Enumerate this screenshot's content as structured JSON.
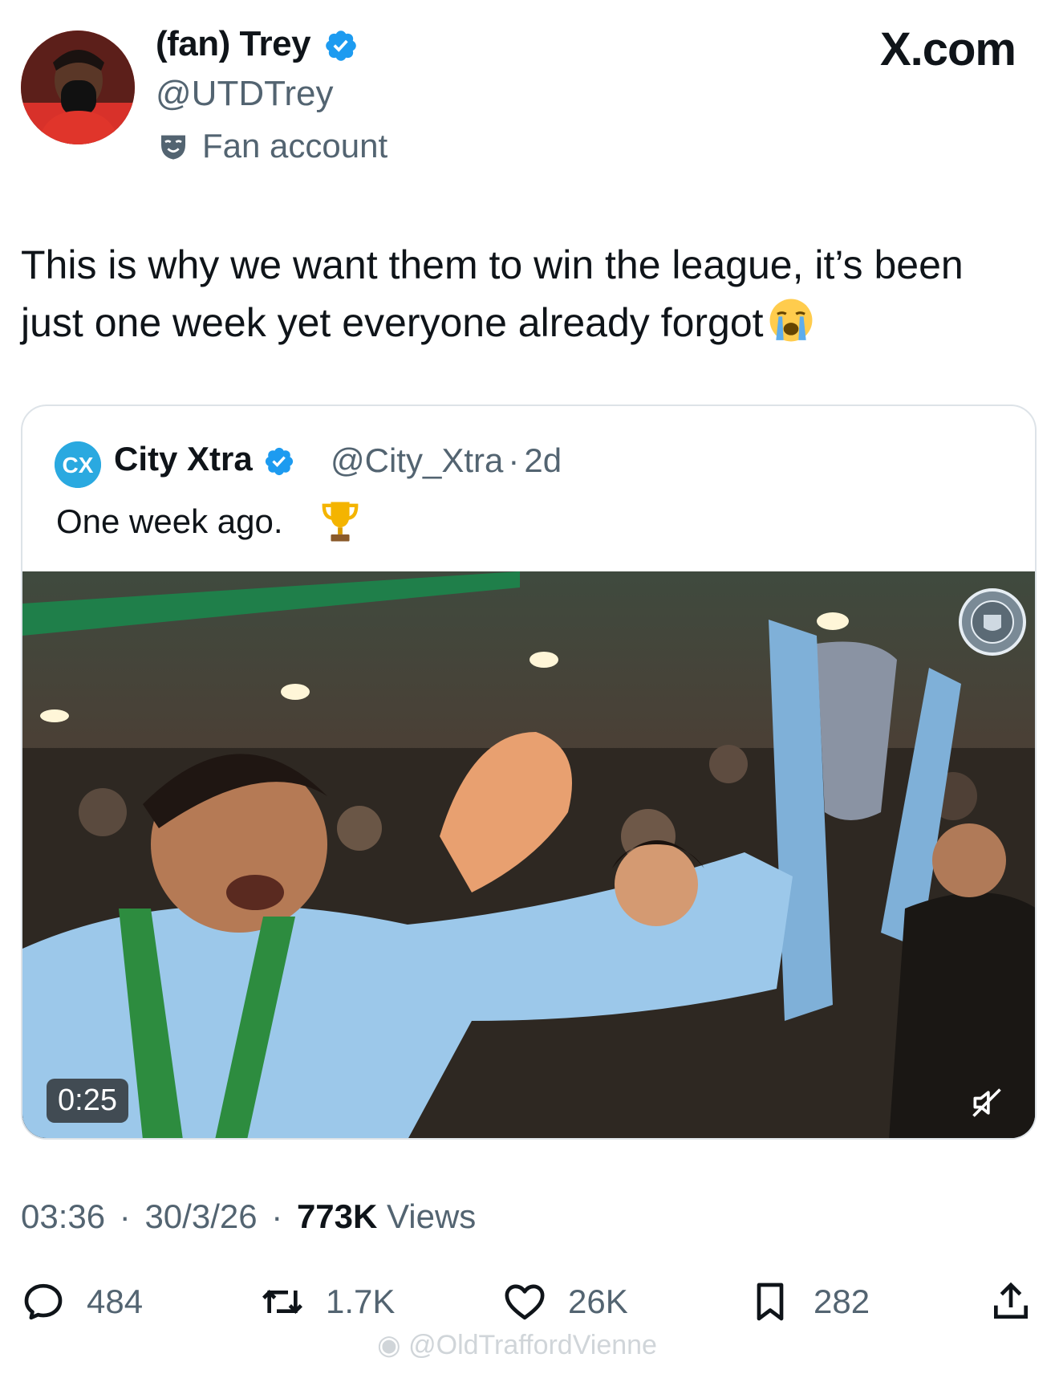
{
  "author": {
    "display_name": "(fan) Trey",
    "handle": "@UTDTrey",
    "label": "Fan account",
    "verified_icon": "verified-badge-icon"
  },
  "site": "X.com",
  "tweet_text": "This is why we want them to win the league, it’s been just one week yet everyone already forgot",
  "tweet_emoji": "loudly-crying-face",
  "quote": {
    "name": "City Xtra",
    "handle": "@City_Xtra",
    "separator": "·",
    "age": "2d",
    "text": "One week ago.",
    "emoji": "trophy",
    "video": {
      "duration": "0:25",
      "muted": true
    }
  },
  "meta": {
    "time": "03:36",
    "date": "30/3/26",
    "views_count": "773K",
    "views_label": "Views"
  },
  "actions": {
    "replies": "484",
    "reposts": "1.7K",
    "likes": "26K",
    "bookmarks": "282"
  },
  "watermark": "@OldTraffordVienne",
  "colors": {
    "verified": "#1d9bf0",
    "secondary_text": "#536471",
    "primary_text": "#0f1419",
    "city_blue": "#98c5e9"
  }
}
